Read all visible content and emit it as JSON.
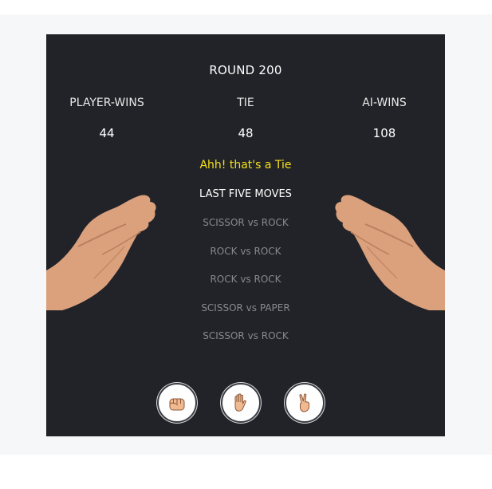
{
  "game": {
    "round": "ROUND 200",
    "player_wins_label": "PLAYER-WINS",
    "tie_label": "TIE",
    "ai_wins_label": "AI-WINS",
    "player_wins": "44",
    "ties": "48",
    "ai_wins": "108",
    "result_message": "Ahh! that's a Tie",
    "history_title": "LAST FIVE MOVES",
    "history": [
      "SCISSOR vs ROCK",
      "ROCK vs ROCK",
      "ROCK vs ROCK",
      "SCISSOR vs PAPER",
      "SCISSOR vs ROCK"
    ],
    "choices": [
      {
        "icon": "rock-fist-icon"
      },
      {
        "icon": "paper-hand-icon"
      },
      {
        "icon": "scissor-hand-icon"
      }
    ]
  },
  "colors": {
    "panel_bg": "#212328",
    "result_text": "#f4e01b",
    "history_text": "#868a90",
    "skin": "#e9b58f"
  }
}
